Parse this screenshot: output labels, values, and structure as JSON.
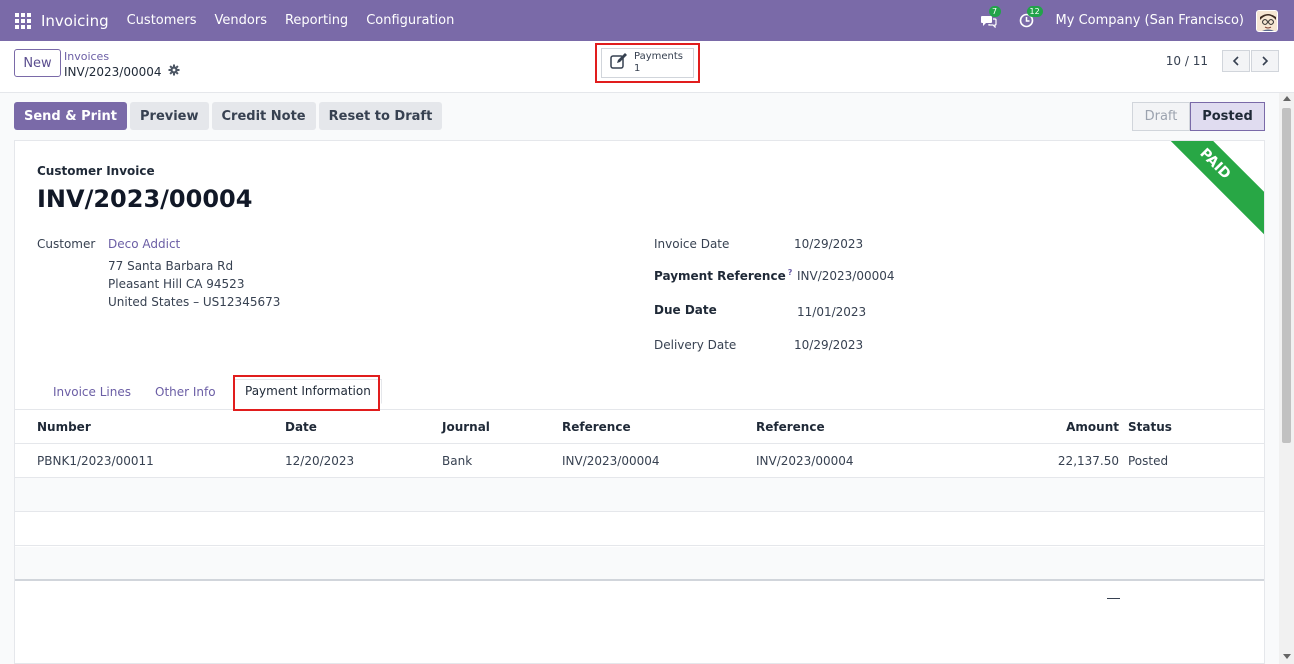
{
  "navbar": {
    "app_title": "Invoicing",
    "menu": [
      "Customers",
      "Vendors",
      "Reporting",
      "Configuration"
    ],
    "messages_badge": "7",
    "activities_badge": "12",
    "company": "My Company (San Francisco)",
    "color": "#7a6aa8"
  },
  "control_panel": {
    "new_label": "New",
    "breadcrumb_parent": "Invoices",
    "breadcrumb_current": "INV/2023/00004",
    "smart_button": {
      "label": "Payments",
      "count": "1"
    },
    "pager": "10 / 11"
  },
  "actions": {
    "send_print": "Send & Print",
    "preview": "Preview",
    "credit_note": "Credit Note",
    "reset_draft": "Reset to Draft"
  },
  "status": {
    "stages": [
      "Draft",
      "Posted"
    ],
    "current": "Posted"
  },
  "invoice": {
    "ribbon": "PAID",
    "type_label": "Customer Invoice",
    "number": "INV/2023/00004",
    "customer_label": "Customer",
    "customer_name": "Deco Addict",
    "address_line1": "77 Santa Barbara Rd",
    "address_line2": "Pleasant Hill CA 94523",
    "address_line3": "United States – US12345673",
    "invoice_date_label": "Invoice Date",
    "invoice_date": "10/29/2023",
    "payment_ref_label": "Payment Reference",
    "payment_ref_help": "?",
    "payment_ref": "INV/2023/00004",
    "due_date_label": "Due Date",
    "due_date": "11/01/2023",
    "delivery_date_label": "Delivery Date",
    "delivery_date": "10/29/2023"
  },
  "tabs": [
    {
      "label": "Invoice Lines"
    },
    {
      "label": "Other Info"
    },
    {
      "label": "Payment Information",
      "active": true
    }
  ],
  "payments_table": {
    "headers": [
      "Number",
      "Date",
      "Journal",
      "Reference",
      "Reference",
      "Amount",
      "Status"
    ],
    "rows": [
      [
        "PBNK1/2023/00011",
        "12/20/2023",
        "Bank",
        "INV/2023/00004",
        "INV/2023/00004",
        "22,137.50",
        "Posted"
      ]
    ]
  }
}
